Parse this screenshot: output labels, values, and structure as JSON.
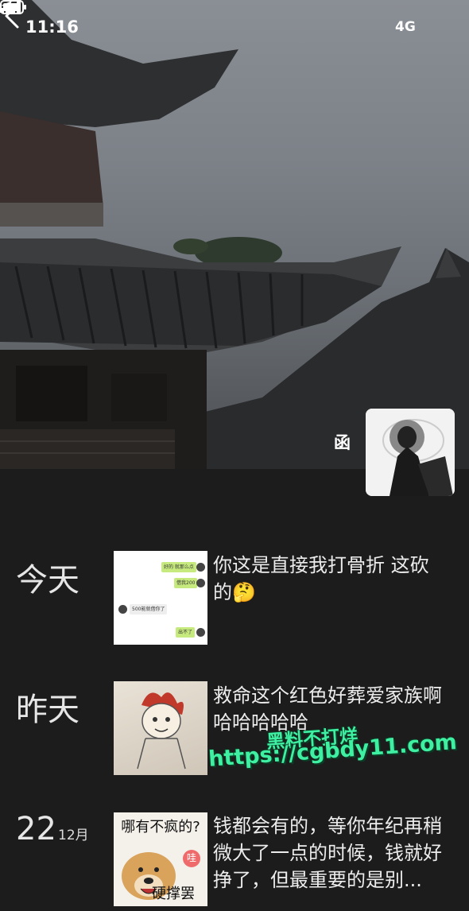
{
  "status_bar": {
    "time": "11:16",
    "network": "4G"
  },
  "profile": {
    "nickname": "函"
  },
  "feed": [
    {
      "date_day": "今天",
      "date_month": "",
      "text": "你这是直接我打骨折 这砍的🤔",
      "thumb_bubbles": [
        "好的 就那么点",
        "借我200",
        "500能就借你了",
        "出不了"
      ]
    },
    {
      "date_day": "昨天",
      "date_month": "",
      "text": "救命这个红色好葬爱家族啊哈哈哈哈哈"
    },
    {
      "date_day": "22",
      "date_month": "12月",
      "text": "钱都会有的，等你年纪再稍微大了一点的时候，钱就好挣了，但最重要的是别...",
      "thumb_top": "哪有不疯的?",
      "thumb_bottom": "硬撑罢",
      "thumb_tag": "哇"
    }
  ],
  "watermark": {
    "line1": "黑料不打烊",
    "line2": "https://cgbdy11.com"
  }
}
